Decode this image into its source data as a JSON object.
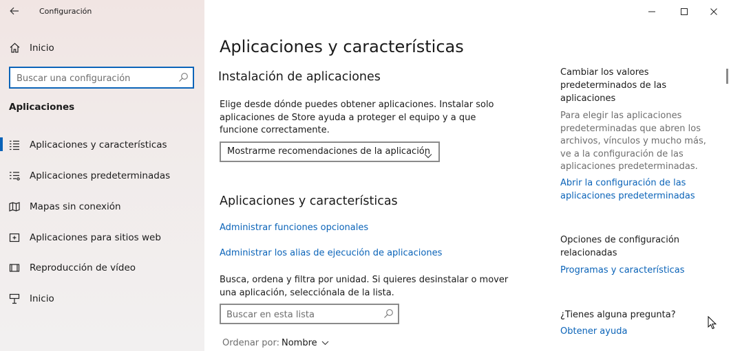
{
  "window": {
    "title": "Configuración",
    "buttons": {
      "minimize": "minimize-icon",
      "maximize": "maximize-icon",
      "close": "close-icon"
    }
  },
  "sidebar": {
    "home_label": "Inicio",
    "search_placeholder": "Buscar una configuración",
    "section_title": "Aplicaciones",
    "items": [
      {
        "label": "Aplicaciones y características",
        "icon": "apps-features-icon",
        "selected": true
      },
      {
        "label": "Aplicaciones predeterminadas",
        "icon": "default-apps-icon",
        "selected": false
      },
      {
        "label": "Mapas sin conexión",
        "icon": "offline-maps-icon",
        "selected": false
      },
      {
        "label": "Aplicaciones para sitios web",
        "icon": "apps-websites-icon",
        "selected": false
      },
      {
        "label": "Reproducción de vídeo",
        "icon": "video-playback-icon",
        "selected": false
      },
      {
        "label": "Inicio",
        "icon": "startup-icon",
        "selected": false
      }
    ]
  },
  "main": {
    "page_title": "Aplicaciones y características",
    "install_section": {
      "heading": "Instalación de aplicaciones",
      "description": "Elige desde dónde puedes obtener aplicaciones. Instalar solo aplicaciones de Store ayuda a proteger el equipo y a que funcione correctamente.",
      "dropdown_value": "Mostrarme recomendaciones de la aplicación"
    },
    "apps_section": {
      "heading": "Aplicaciones y características",
      "link_optional": "Administrar funciones opcionales",
      "link_alias": "Administrar los alias de ejecución de aplicaciones",
      "description": "Busca, ordena y filtra por unidad. Si quieres desinstalar o mover una aplicación, selecciónala de la lista.",
      "search_placeholder": "Buscar en esta lista",
      "sort_label": "Ordenar por:",
      "sort_value": "Nombre"
    }
  },
  "side_panel": {
    "defaults_heading": "Cambiar los valores predeterminados de las aplicaciones",
    "defaults_text": "Para elegir las aplicaciones predeterminadas que abren los archivos, vínculos y mucho más, ve a la configuración de las aplicaciones predeterminadas.",
    "defaults_link": "Abrir la configuración de las aplicaciones predeterminadas",
    "related_heading": "Opciones de configuración relacionadas",
    "related_link": "Programas y características",
    "question_heading": "¿Tienes alguna pregunta?",
    "help_link": "Obtener ayuda"
  },
  "colors": {
    "accent": "#0a63b8",
    "sidebar_bg": "#f1ebea",
    "secondary_text": "#6d6d6d"
  }
}
